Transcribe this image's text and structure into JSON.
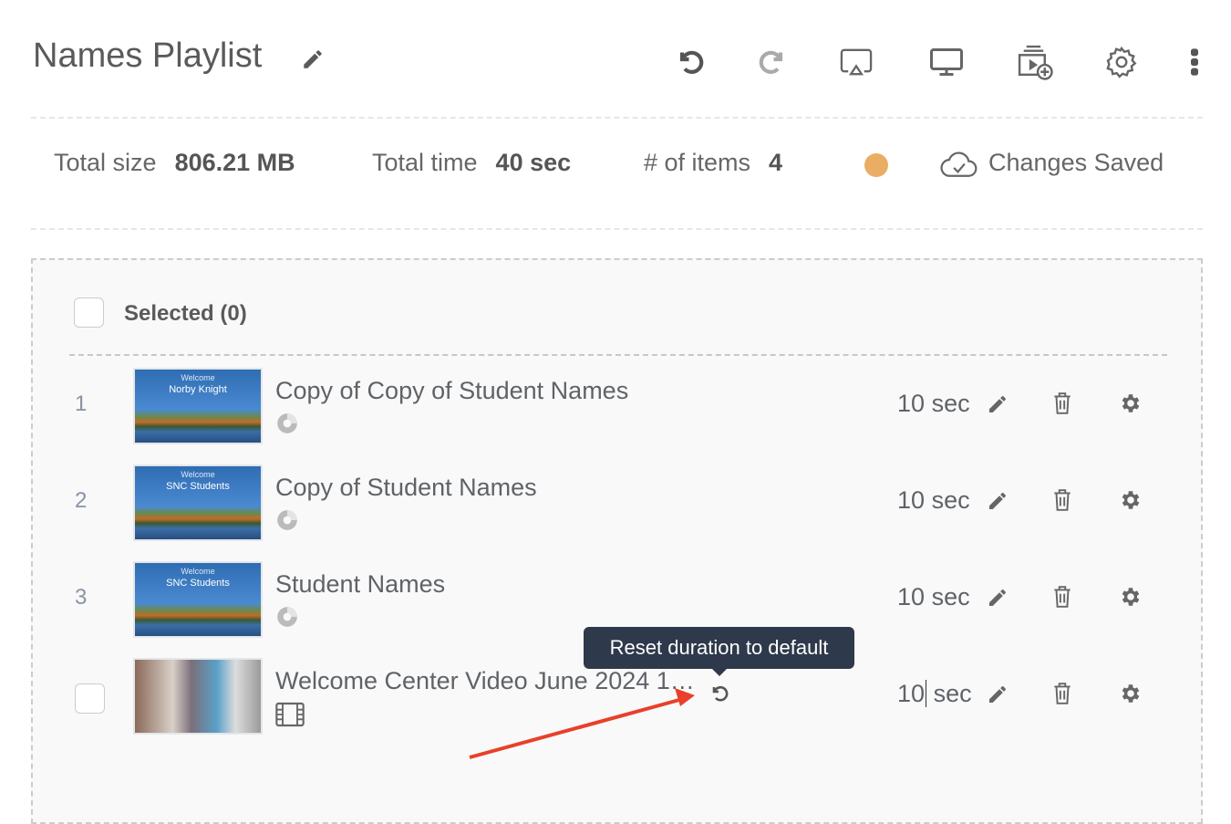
{
  "header": {
    "title": "Names Playlist",
    "edit_icon": "pencil-icon",
    "toolbar": [
      {
        "name": "undo",
        "icon": "undo-icon"
      },
      {
        "name": "redo",
        "icon": "redo-icon"
      },
      {
        "name": "cast",
        "icon": "airplay-icon"
      },
      {
        "name": "preview",
        "icon": "monitor-icon"
      },
      {
        "name": "add-media",
        "icon": "playlist-add-icon"
      },
      {
        "name": "settings",
        "icon": "gear-icon"
      },
      {
        "name": "more",
        "icon": "more-vertical-icon"
      }
    ]
  },
  "stats": {
    "size_label": "Total size",
    "size_value": "806.21 MB",
    "time_label": "Total time",
    "time_value": "40 sec",
    "items_label": "# of items",
    "items_value": "4",
    "status_color": "#e9ad63",
    "save_status": "Changes Saved"
  },
  "list": {
    "selected_label": "Selected (0)",
    "items": [
      {
        "index": "1",
        "name": "Copy of Copy of Student Names",
        "thumb_line1": "Welcome",
        "thumb_line2": "Norby Knight",
        "type": "app",
        "duration": "10",
        "unit": "sec"
      },
      {
        "index": "2",
        "name": "Copy of Student Names",
        "thumb_line1": "Welcome",
        "thumb_line2": "SNC Students",
        "type": "app",
        "duration": "10",
        "unit": "sec"
      },
      {
        "index": "3",
        "name": "Student Names",
        "thumb_line1": "Welcome",
        "thumb_line2": "SNC Students",
        "type": "app",
        "duration": "10",
        "unit": "sec"
      },
      {
        "index": "",
        "name": "Welcome Center Video June 2024 1…",
        "thumb_line1": "",
        "thumb_line2": "",
        "type": "video",
        "duration": "10",
        "unit": "sec",
        "reset_icon": "reset-icon"
      }
    ]
  },
  "tooltip": "Reset duration to default",
  "annotation_color": "#e8402a"
}
